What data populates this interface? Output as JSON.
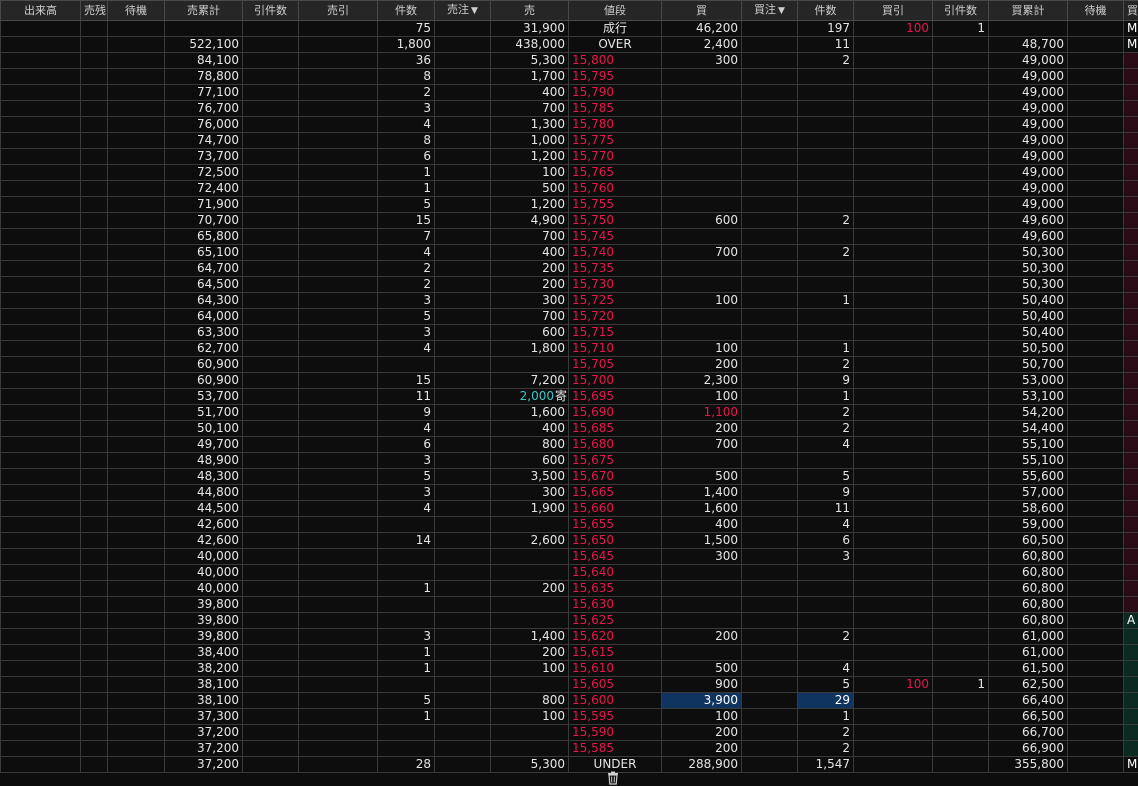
{
  "headers": {
    "volume": "出来高",
    "sell_remain": "売残",
    "sell_wait": "待機",
    "sell_cum": "売累計",
    "sell_pull_count": "引件数",
    "sell_pull": "売引",
    "sell_count": "件数",
    "sell_order": "売注",
    "sell": "売",
    "price": "値段",
    "buy": "買",
    "buy_order": "買注",
    "buy_count": "件数",
    "buy_pull": "買引",
    "buy_pull_count": "引件数",
    "buy_cum": "買累計",
    "buy_wait": "待機",
    "buy_remain": "買残"
  },
  "sort_arrow": "▼",
  "colors": {
    "ask_price": "#e5184a",
    "highlight": "#0f3460",
    "cyan_value": "#3ec7c7",
    "sell_flag_bg": "#2a0c16",
    "buy_flag_bg": "#0b2a22"
  },
  "rows": [
    {
      "sell_cum": "",
      "sell_count": "75",
      "sell": "31,900",
      "price": "成行",
      "price_style": "plain",
      "buy": "46,200",
      "buy_count": "197",
      "buy_pull": "100",
      "buy_pull_count": "1",
      "buy_cum": "",
      "flag": "M",
      "flag_style": "none"
    },
    {
      "sell_cum": "522,100",
      "sell_count": "1,800",
      "sell": "438,000",
      "price": "OVER",
      "price_style": "plain",
      "buy": "2,400",
      "buy_count": "11",
      "buy_cum": "48,700",
      "flag": "M",
      "flag_style": "none"
    },
    {
      "sell_cum": "84,100",
      "sell_count": "36",
      "sell": "5,300",
      "price": "15,800",
      "buy": "300",
      "buy_count": "2",
      "buy_cum": "49,000",
      "flag_style": "red"
    },
    {
      "sell_cum": "78,800",
      "sell_count": "8",
      "sell": "1,700",
      "price": "15,795",
      "buy_cum": "49,000",
      "flag_style": "red"
    },
    {
      "sell_cum": "77,100",
      "sell_count": "2",
      "sell": "400",
      "price": "15,790",
      "buy_cum": "49,000",
      "flag_style": "red"
    },
    {
      "sell_cum": "76,700",
      "sell_count": "3",
      "sell": "700",
      "price": "15,785",
      "buy_cum": "49,000",
      "flag_style": "red"
    },
    {
      "sell_cum": "76,000",
      "sell_count": "4",
      "sell": "1,300",
      "price": "15,780",
      "buy_cum": "49,000",
      "flag_style": "red"
    },
    {
      "sell_cum": "74,700",
      "sell_count": "8",
      "sell": "1,000",
      "price": "15,775",
      "buy_cum": "49,000",
      "flag_style": "red"
    },
    {
      "sell_cum": "73,700",
      "sell_count": "6",
      "sell": "1,200",
      "price": "15,770",
      "buy_cum": "49,000",
      "flag_style": "red"
    },
    {
      "sell_cum": "72,500",
      "sell_count": "1",
      "sell": "100",
      "price": "15,765",
      "buy_cum": "49,000",
      "flag_style": "red"
    },
    {
      "sell_cum": "72,400",
      "sell_count": "1",
      "sell": "500",
      "price": "15,760",
      "buy_cum": "49,000",
      "flag_style": "red"
    },
    {
      "sell_cum": "71,900",
      "sell_count": "5",
      "sell": "1,200",
      "price": "15,755",
      "buy_cum": "49,000",
      "flag_style": "red"
    },
    {
      "sell_cum": "70,700",
      "sell_count": "15",
      "sell": "4,900",
      "price": "15,750",
      "buy": "600",
      "buy_count": "2",
      "buy_cum": "49,600",
      "flag_style": "red"
    },
    {
      "sell_cum": "65,800",
      "sell_count": "7",
      "sell": "700",
      "price": "15,745",
      "buy_cum": "49,600",
      "flag_style": "red"
    },
    {
      "sell_cum": "65,100",
      "sell_count": "4",
      "sell": "400",
      "price": "15,740",
      "buy": "700",
      "buy_count": "2",
      "buy_cum": "50,300",
      "flag_style": "red"
    },
    {
      "sell_cum": "64,700",
      "sell_count": "2",
      "sell": "200",
      "price": "15,735",
      "buy_cum": "50,300",
      "flag_style": "red"
    },
    {
      "sell_cum": "64,500",
      "sell_count": "2",
      "sell": "200",
      "price": "15,730",
      "buy_cum": "50,300",
      "flag_style": "red"
    },
    {
      "sell_cum": "64,300",
      "sell_count": "3",
      "sell": "300",
      "price": "15,725",
      "buy": "100",
      "buy_count": "1",
      "buy_cum": "50,400",
      "flag_style": "red"
    },
    {
      "sell_cum": "64,000",
      "sell_count": "5",
      "sell": "700",
      "price": "15,720",
      "buy_cum": "50,400",
      "flag_style": "red"
    },
    {
      "sell_cum": "63,300",
      "sell_count": "3",
      "sell": "600",
      "price": "15,715",
      "buy_cum": "50,400",
      "flag_style": "red"
    },
    {
      "sell_cum": "62,700",
      "sell_count": "4",
      "sell": "1,800",
      "price": "15,710",
      "buy": "100",
      "buy_count": "1",
      "buy_cum": "50,500",
      "flag_style": "red"
    },
    {
      "sell_cum": "60,900",
      "price": "15,705",
      "buy": "200",
      "buy_count": "2",
      "buy_cum": "50,700",
      "flag_style": "red"
    },
    {
      "sell_cum": "60,900",
      "sell_count": "15",
      "sell": "7,200",
      "price": "15,700",
      "buy": "2,300",
      "buy_count": "9",
      "buy_cum": "53,000",
      "flag_style": "red"
    },
    {
      "sell_cum": "53,700",
      "sell_count": "11",
      "sell": "2,000",
      "sell_style": "cyan",
      "price_mark": "寄",
      "price": "15,695",
      "buy": "100",
      "buy_count": "1",
      "buy_cum": "53,100",
      "flag_style": "red"
    },
    {
      "sell_cum": "51,700",
      "sell_count": "9",
      "sell": "1,600",
      "price": "15,690",
      "buy": "1,100",
      "buy_style": "red",
      "buy_count": "2",
      "buy_cum": "54,200",
      "flag_style": "red"
    },
    {
      "sell_cum": "50,100",
      "sell_count": "4",
      "sell": "400",
      "price": "15,685",
      "buy": "200",
      "buy_count": "2",
      "buy_cum": "54,400",
      "flag_style": "red"
    },
    {
      "sell_cum": "49,700",
      "sell_count": "6",
      "sell": "800",
      "price": "15,680",
      "buy": "700",
      "buy_count": "4",
      "buy_cum": "55,100",
      "flag_style": "red"
    },
    {
      "sell_cum": "48,900",
      "sell_count": "3",
      "sell": "600",
      "price": "15,675",
      "buy_cum": "55,100",
      "flag_style": "red"
    },
    {
      "sell_cum": "48,300",
      "sell_count": "5",
      "sell": "3,500",
      "price": "15,670",
      "buy": "500",
      "buy_count": "5",
      "buy_cum": "55,600",
      "flag_style": "red"
    },
    {
      "sell_cum": "44,800",
      "sell_count": "3",
      "sell": "300",
      "price": "15,665",
      "buy": "1,400",
      "buy_count": "9",
      "buy_cum": "57,000",
      "flag_style": "red"
    },
    {
      "sell_cum": "44,500",
      "sell_count": "4",
      "sell": "1,900",
      "price": "15,660",
      "buy": "1,600",
      "buy_count": "11",
      "buy_cum": "58,600",
      "flag_style": "red"
    },
    {
      "sell_cum": "42,600",
      "price": "15,655",
      "buy": "400",
      "buy_count": "4",
      "buy_cum": "59,000",
      "flag_style": "red"
    },
    {
      "sell_cum": "42,600",
      "sell_count": "14",
      "sell": "2,600",
      "price": "15,650",
      "buy": "1,500",
      "buy_count": "6",
      "buy_cum": "60,500",
      "flag_style": "red"
    },
    {
      "sell_cum": "40,000",
      "price": "15,645",
      "buy": "300",
      "buy_count": "3",
      "buy_cum": "60,800",
      "flag_style": "red"
    },
    {
      "sell_cum": "40,000",
      "price": "15,640",
      "buy_cum": "60,800",
      "flag_style": "red"
    },
    {
      "sell_cum": "40,000",
      "sell_count": "1",
      "sell": "200",
      "price": "15,635",
      "buy_cum": "60,800",
      "flag_style": "red"
    },
    {
      "sell_cum": "39,800",
      "price": "15,630",
      "buy_cum": "60,800",
      "flag_style": "red"
    },
    {
      "sell_cum": "39,800",
      "price": "15,625",
      "buy_cum": "60,800",
      "flag": "A",
      "flag_style": "green"
    },
    {
      "sell_cum": "39,800",
      "sell_count": "3",
      "sell": "1,400",
      "price": "15,620",
      "buy": "200",
      "buy_count": "2",
      "buy_cum": "61,000",
      "flag_style": "green"
    },
    {
      "sell_cum": "38,400",
      "sell_count": "1",
      "sell": "200",
      "price": "15,615",
      "buy_cum": "61,000",
      "flag_style": "green"
    },
    {
      "sell_cum": "38,200",
      "sell_count": "1",
      "sell": "100",
      "price": "15,610",
      "buy": "500",
      "buy_count": "4",
      "buy_cum": "61,500",
      "flag_style": "green"
    },
    {
      "sell_cum": "38,100",
      "price": "15,605",
      "buy": "900",
      "buy_count": "5",
      "buy_pull": "100",
      "buy_pull_count": "1",
      "buy_cum": "62,500",
      "flag_style": "green"
    },
    {
      "sell_cum": "38,100",
      "sell_count": "5",
      "sell": "800",
      "price": "15,600",
      "buy": "3,900",
      "buy_style": "hl",
      "buy_count": "29",
      "buy_count_style": "hl",
      "buy_cum": "66,400",
      "flag_style": "green"
    },
    {
      "sell_cum": "37,300",
      "sell_count": "1",
      "sell": "100",
      "price": "15,595",
      "buy": "100",
      "buy_count": "1",
      "buy_cum": "66,500",
      "flag_style": "green"
    },
    {
      "sell_cum": "37,200",
      "price": "15,590",
      "buy": "200",
      "buy_count": "2",
      "buy_cum": "66,700",
      "flag_style": "green"
    },
    {
      "sell_cum": "37,200",
      "price": "15,585",
      "buy": "200",
      "buy_count": "2",
      "buy_cum": "66,900",
      "flag_style": "green"
    },
    {
      "sell_cum": "37,200",
      "sell_count": "28",
      "sell": "5,300",
      "price": "UNDER",
      "price_style": "plain",
      "buy": "288,900",
      "buy_count": "1,547",
      "buy_cum": "355,800",
      "flag": "M",
      "flag_style": "none"
    }
  ],
  "footer": {
    "icon": "trash-icon"
  }
}
